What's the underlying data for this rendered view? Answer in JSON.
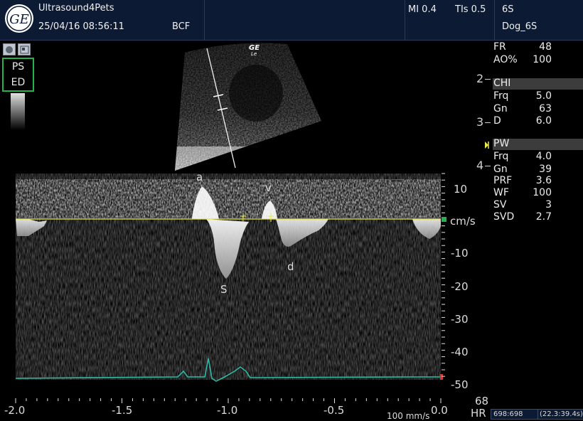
{
  "header": {
    "app_name": "Ultrasound4Pets",
    "datetime": "25/04/16 08:56:11",
    "preset_code": "BCF",
    "mi": "MI 0.4",
    "tis": "TIs 0.5",
    "probe": "6S",
    "preset_name": "Dog_6S",
    "logo_text": "GE"
  },
  "left": {
    "ps_label": "PS",
    "ed_label": "ED"
  },
  "image": {
    "brand": "GE",
    "brand_sub": "Le"
  },
  "depth_marks": [
    "2",
    "3",
    "4"
  ],
  "params": {
    "general": [
      {
        "label": "FR",
        "value": "48"
      },
      {
        "label": "AO%",
        "value": "100"
      }
    ],
    "chi": {
      "title": "CHI",
      "rows": [
        {
          "label": "Frq",
          "value": "5.0"
        },
        {
          "label": "Gn",
          "value": "63"
        },
        {
          "label": "D",
          "value": "6.0"
        }
      ]
    },
    "pw": {
      "title": "PW",
      "rows": [
        {
          "label": "Frq",
          "value": "4.0"
        },
        {
          "label": "Gn",
          "value": "39"
        },
        {
          "label": "PRF",
          "value": "3.6"
        },
        {
          "label": "WF",
          "value": "100"
        },
        {
          "label": "SV",
          "value": "3"
        },
        {
          "label": "SVD",
          "value": "2.7"
        }
      ]
    }
  },
  "spectrum": {
    "velocity_unit": "cm/s",
    "velocity_ticks": [
      "10",
      "-10",
      "-20",
      "-30",
      "-40",
      "-50"
    ],
    "time_ticks": [
      "-2.0",
      "-1.5",
      "-1.0",
      "-0.5",
      "0.0"
    ],
    "waves": {
      "a": "a",
      "v": "v",
      "S": "S",
      "d": "d"
    },
    "hr_value": "68",
    "hr_label": "HR",
    "sweep": "100 mm/s",
    "frame_counter": "698:698",
    "time_counter": "(22.3:39.4s)"
  },
  "colors": {
    "header_bg": "#0c1a33",
    "baseline": "#e8e84a",
    "ecg": "#2fb8a4",
    "frame_green": "#23b24b"
  }
}
